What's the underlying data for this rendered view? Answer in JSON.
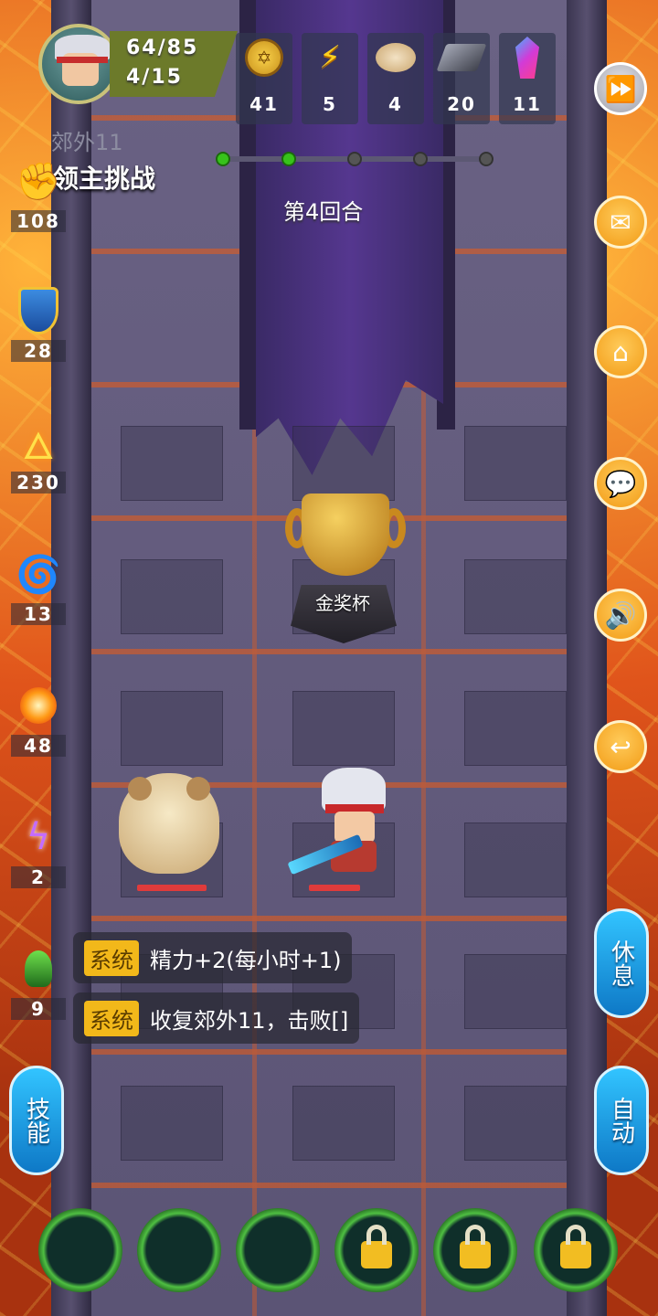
{
  "player": {
    "hp_text": "64/85",
    "level_text": "4/15"
  },
  "resources": [
    {
      "icon": "gold-coin-icon",
      "value": "41"
    },
    {
      "icon": "lightning-energy-icon",
      "value": "5"
    },
    {
      "icon": "bun-food-icon",
      "value": "4"
    },
    {
      "icon": "iron-ingot-icon",
      "value": "20"
    },
    {
      "icon": "crystal-gem-icon",
      "value": "11"
    }
  ],
  "stage": {
    "name": "郊外11",
    "mode": "领主挑战",
    "round": "第4回合",
    "progress_total": 5,
    "progress_done": 2
  },
  "left_stats": [
    {
      "icon": "fist-attack-icon",
      "value": "108"
    },
    {
      "icon": "shield-defense-icon",
      "value": "28"
    },
    {
      "icon": "flame-sword-icon",
      "value": "230"
    },
    {
      "icon": "water-swirl-icon",
      "value": "13"
    },
    {
      "icon": "fire-burst-icon",
      "value": "48"
    },
    {
      "icon": "purple-lightning-icon",
      "value": "2"
    },
    {
      "icon": "green-claw-icon",
      "value": "9"
    }
  ],
  "trophy": {
    "label": "金奖杯"
  },
  "chat": [
    {
      "tag": "系统",
      "text": "精力+2(每小时+1)"
    },
    {
      "tag": "系统",
      "text": "收复郊外11，击败[]"
    }
  ],
  "buttons": {
    "rest": "休息",
    "auto": "自动",
    "skills": "技能"
  },
  "skill_slots": [
    {
      "locked": false
    },
    {
      "locked": false
    },
    {
      "locked": false
    },
    {
      "locked": true
    },
    {
      "locked": true
    },
    {
      "locked": true
    }
  ],
  "colors": {
    "lava": "#c2491c",
    "floor": "#5b5475",
    "banner": "#55378f",
    "accent_orange": "#f29b16",
    "accent_blue": "#0e78c6",
    "tag_yellow": "#f2b81a"
  }
}
